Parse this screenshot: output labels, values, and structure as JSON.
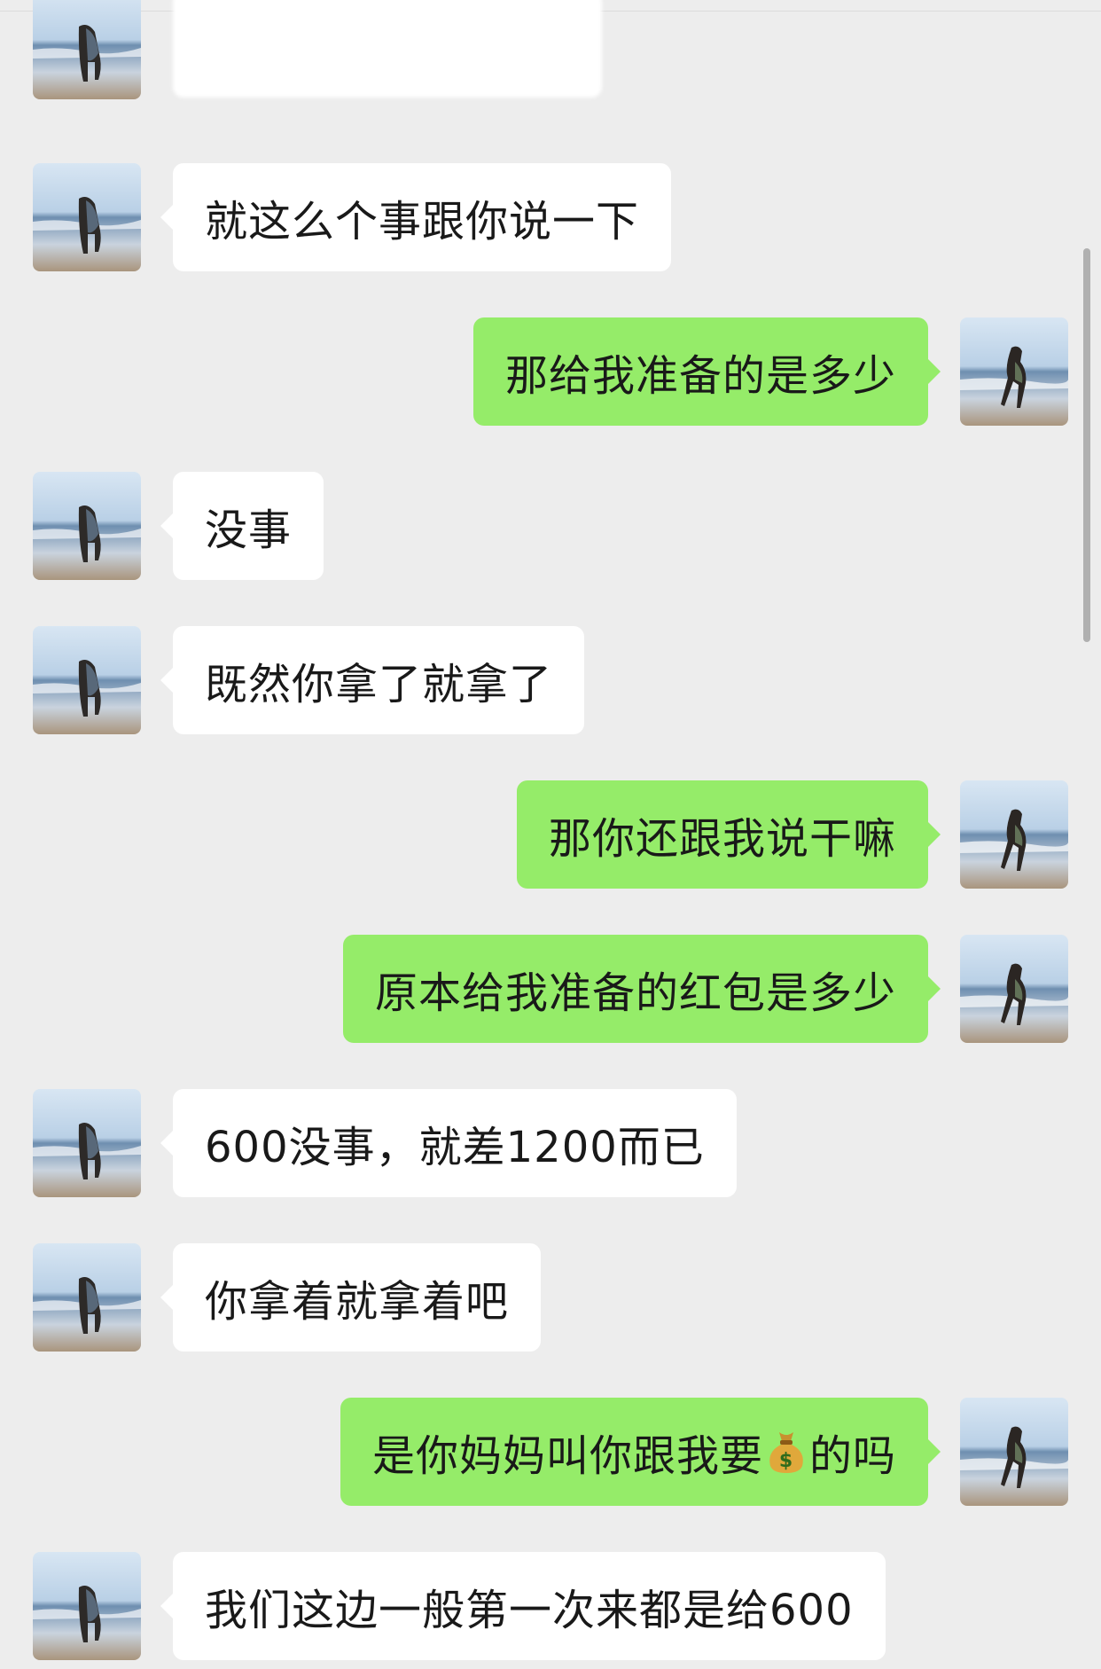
{
  "chat": {
    "messages": [
      {
        "side": "left",
        "text": ""
      },
      {
        "side": "left",
        "text": "就这么个事跟你说一下"
      },
      {
        "side": "right",
        "text": "那给我准备的是多少"
      },
      {
        "side": "left",
        "text": "没事"
      },
      {
        "side": "left",
        "text": "既然你拿了就拿了"
      },
      {
        "side": "right",
        "text": "那你还跟我说干嘛"
      },
      {
        "side": "right",
        "text": "原本给我准备的红包是多少"
      },
      {
        "side": "left",
        "text": "600没事，就差1200而已"
      },
      {
        "side": "left",
        "text": "你拿着就拿着吧"
      },
      {
        "side": "right",
        "text_before_icon": "是你妈妈叫你跟我要",
        "icon": "money-bag-icon",
        "text_after_icon": "的吗"
      },
      {
        "side": "left",
        "text": "我们这边一般第一次来都是给600"
      }
    ]
  },
  "colors": {
    "background": "#ededed",
    "incoming_bubble": "#ffffff",
    "outgoing_bubble": "#95ec69",
    "text": "#191919"
  }
}
